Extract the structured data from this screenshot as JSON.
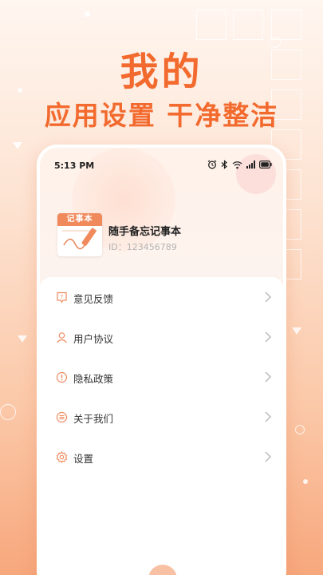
{
  "promo": {
    "title": "我的",
    "subtitle": "应用设置 干净整洁"
  },
  "status_bar": {
    "time": "5:13 PM",
    "icons": [
      "alarm-icon",
      "bluetooth-icon",
      "wifi-icon",
      "signal-icon",
      "battery-icon"
    ]
  },
  "profile": {
    "app_icon_label": "记事本",
    "app_name": "随手备忘记事本",
    "app_id": "ID：123456789"
  },
  "menu": {
    "items": [
      {
        "label": "意见反馈",
        "icon": "feedback-icon"
      },
      {
        "label": "用户协议",
        "icon": "user-icon"
      },
      {
        "label": "隐私政策",
        "icon": "warning-icon"
      },
      {
        "label": "关于我们",
        "icon": "info-list-icon"
      },
      {
        "label": "设置",
        "icon": "gear-icon"
      }
    ]
  },
  "colors": {
    "accent": "#f26a2e",
    "icon_stroke": "#f08a5d",
    "text": "#333333",
    "muted": "#b3b3b3"
  }
}
